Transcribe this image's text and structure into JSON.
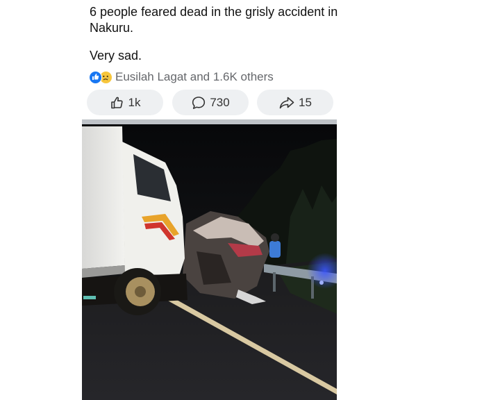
{
  "post": {
    "text_line1": "6 people feared dead in the grisly accident in Nakuru.",
    "text_line2": "Very sad.",
    "reactions": {
      "icons": [
        "like-icon",
        "sad-face-icon"
      ],
      "summary": "Eusilah Lagat and 1.6K others"
    },
    "actions": {
      "like_count": "1k",
      "comment_count": "730",
      "share_count": "15"
    },
    "photo": {
      "subject": "night-time truck crash on highway"
    }
  },
  "colors": {
    "like_blue": "#1877f2",
    "sad_yellow": "#f7c63c",
    "button_bg": "#eef0f2",
    "meta_text": "#65676b"
  }
}
